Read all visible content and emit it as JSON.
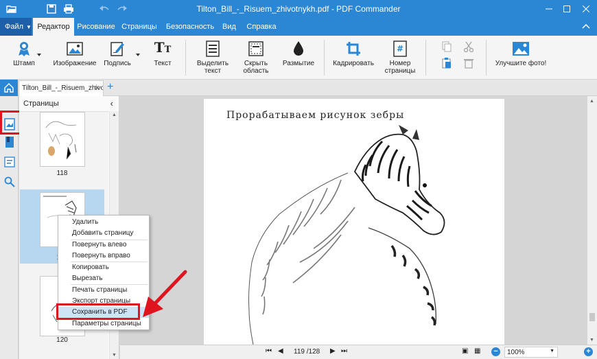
{
  "window": {
    "title": "Tilton_Bill_-_Risuem_zhivotnykh.pdf - PDF Commander"
  },
  "menu": {
    "file_label": "Файл",
    "tabs": [
      "Редактор",
      "Рисование",
      "Страницы",
      "Безопасность",
      "Вид",
      "Справка"
    ],
    "active_tab": "Редактор"
  },
  "ribbon": {
    "stamp": "Штамп",
    "image": "Изображение",
    "signature": "Подпись",
    "text": "Текст",
    "select_text_1": "Выделить",
    "select_text_2": "текст",
    "hide_area_1": "Скрыть",
    "hide_area_2": "область",
    "blur": "Размытие",
    "crop": "Кадрировать",
    "page_number_1": "Номер",
    "page_number_2": "страницы",
    "improve_photo": "Улучшите фото!"
  },
  "doc_tab": {
    "name": "Tilton_Bill_-_Risuem_zhivo",
    "close": "✕",
    "add": "+"
  },
  "pages_panel": {
    "title": "Страницы",
    "collapse_icon": "‹",
    "thumb_labels": [
      "118",
      "119",
      "120"
    ]
  },
  "page": {
    "heading": "Прорабатываем рисунок зебры"
  },
  "status": {
    "current_page": "119",
    "total_pages": "/128",
    "zoom": "100%"
  },
  "context_menu": {
    "items": [
      "Удалить",
      "Добавить страницу",
      "Повернуть влево",
      "Повернуть вправо",
      "Копировать",
      "Вырезать",
      "Печать страницы",
      "Экспорт страницы",
      "Сохранить в PDF",
      "Параметры страницы"
    ],
    "highlighted": "Сохранить в PDF"
  },
  "colors": {
    "accent": "#2b86d4",
    "file_button": "#1d5fa8",
    "annotation_red": "#e0141e",
    "selection": "#b7d7f0",
    "menu_highlight": "#cfe3f5"
  }
}
